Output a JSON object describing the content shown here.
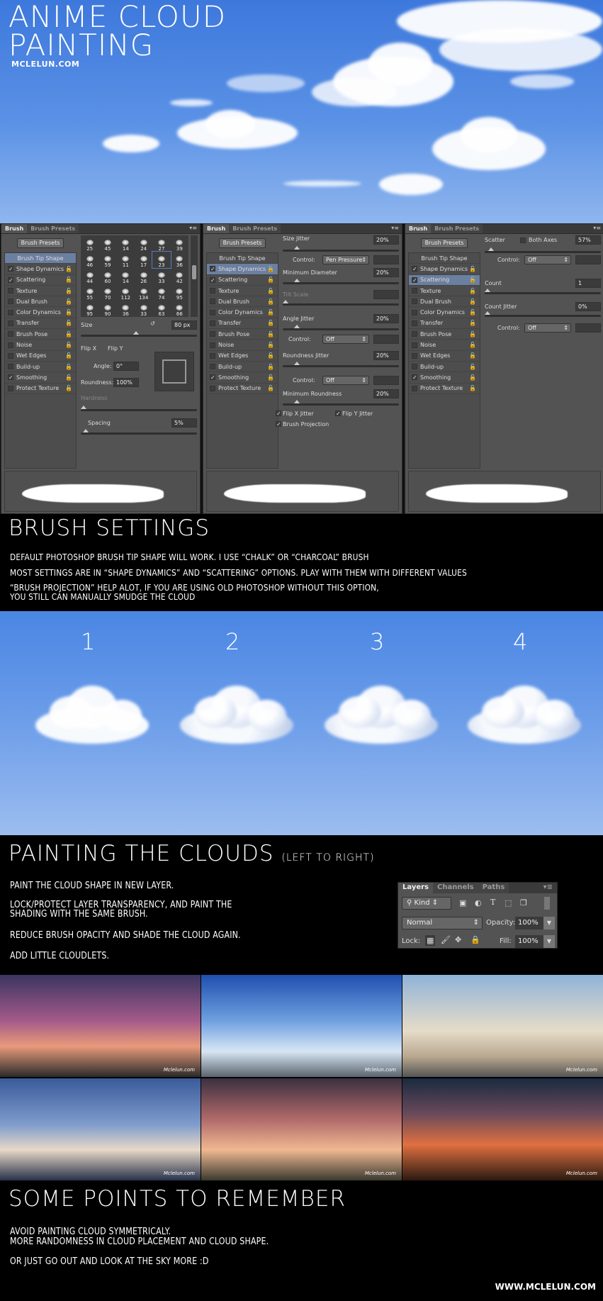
{
  "hero": {
    "title_line1": "ANIME CLOUD",
    "title_line2": "PAINTING",
    "site": "MCLELUN.COM"
  },
  "panels": [
    {
      "tabs": [
        "Brush",
        "Brush Presets"
      ],
      "presets_button": "Brush Presets",
      "selected": "Brush Tip Shape",
      "options": {
        "grid": [
          "25",
          "45",
          "14",
          "24",
          "27",
          "39",
          "46",
          "59",
          "11",
          "17",
          "23",
          "36",
          "44",
          "60",
          "14",
          "26",
          "33",
          "42",
          "55",
          "70",
          "112",
          "134",
          "74",
          "95",
          "95",
          "90",
          "36",
          "33",
          "63",
          "66"
        ],
        "selected_cell": "23",
        "size_label": "Size",
        "size_value": "80 px",
        "flip_x": "Flip X",
        "flip_y": "Flip Y",
        "angle_label": "Angle:",
        "angle_value": "0°",
        "roundness_label": "Roundness:",
        "roundness_value": "100%",
        "hardness_label": "Hardness",
        "spacing_label": "Spacing",
        "spacing_value": "5%"
      }
    },
    {
      "tabs": [
        "Brush",
        "Brush Presets"
      ],
      "presets_button": "Brush Presets",
      "selected": "Shape Dynamics",
      "options": {
        "size_jitter": "Size Jitter",
        "size_jitter_value": "20%",
        "control_label": "Control:",
        "control1": "Pen Pressure",
        "min_diameter": "Minimum Diameter",
        "min_diameter_value": "20%",
        "tilt_scale": "Tilt Scale",
        "angle_jitter": "Angle Jitter",
        "angle_jitter_value": "20%",
        "control2": "Off",
        "roundness_jitter": "Roundness Jitter",
        "roundness_jitter_value": "20%",
        "control3": "Off",
        "min_roundness": "Minimum Roundness",
        "min_roundness_value": "20%",
        "flip_x_jitter": "Flip X Jitter",
        "flip_y_jitter": "Flip Y Jitter",
        "brush_projection": "Brush Projection"
      }
    },
    {
      "tabs": [
        "Brush",
        "Brush Presets"
      ],
      "presets_button": "Brush Presets",
      "selected": "Scattering",
      "options": {
        "scatter": "Scatter",
        "both_axes": "Both Axes",
        "scatter_value": "57%",
        "control_label": "Control:",
        "control1": "Off",
        "count": "Count",
        "count_value": "1",
        "count_jitter": "Count Jitter",
        "count_jitter_value": "0%",
        "control2": "Off"
      }
    }
  ],
  "brush_list": [
    {
      "label": "Brush Tip Shape",
      "head": true
    },
    {
      "label": "Shape Dynamics",
      "checked": true
    },
    {
      "label": "Scattering",
      "checked": true
    },
    {
      "label": "Texture",
      "checked": false
    },
    {
      "label": "Dual Brush",
      "checked": false
    },
    {
      "label": "Color Dynamics",
      "checked": false
    },
    {
      "label": "Transfer",
      "checked": false
    },
    {
      "label": "Brush Pose",
      "checked": false
    },
    {
      "label": "Noise",
      "checked": false
    },
    {
      "label": "Wet Edges",
      "checked": false
    },
    {
      "label": "Build-up",
      "checked": false
    },
    {
      "label": "Smoothing",
      "checked": true
    },
    {
      "label": "Protect Texture",
      "checked": false
    }
  ],
  "brush_settings": {
    "title": "BRUSH SETTINGS",
    "lines": [
      "DEFAULT PHOTOSHOP BRUSH TIP SHAPE WILL WORK. I USE “CHALK” OR “CHARCOAL” BRUSH",
      "MOST SETTINGS ARE IN “SHAPE DYNAMICS” AND “SCATTERING” OPTIONS. PLAY WITH THEM WITH DIFFERENT VALUES",
      "“BRUSH PROJECTION” HELP ALOT, IF YOU ARE USING OLD PHOTOSHOP WITHOUT THIS OPTION,",
      "YOU STILL CAN MANUALLY SMUDGE THE CLOUD"
    ]
  },
  "steps": [
    "1",
    "2",
    "3",
    "4"
  ],
  "painting": {
    "title": "PAINTING THE CLOUDS",
    "subtitle": "(LEFT TO RIGHT)",
    "lines": [
      "PAINT THE CLOUD SHAPE IN NEW LAYER.",
      "LOCK/PROTECT LAYER TRANSPARENCY, AND PAINT THE",
      "SHADING WITH THE SAME BRUSH.",
      "REDUCE BRUSH OPACITY AND SHADE THE CLOUD AGAIN.",
      "ADD LITTLE CLOUDLETS."
    ]
  },
  "layers_panel": {
    "tabs": [
      "Layers",
      "Channels",
      "Paths"
    ],
    "kind": "Kind",
    "blend": "Normal",
    "opacity_label": "Opacity:",
    "opacity": "100%",
    "lock_label": "Lock:",
    "fill_label": "Fill:",
    "fill": "100%"
  },
  "photos": {
    "signature": "Mclelun.com"
  },
  "points": {
    "title": "SOME POINTS TO REMEMBER",
    "lines": [
      "AVOID PAINTING CLOUD SYMMETRICALY.",
      "MORE RANDOMNESS IN CLOUD PLACEMENT AND CLOUD SHAPE.",
      "OR JUST GO OUT AND LOOK AT THE SKY MORE :D"
    ],
    "url": "WWW.MCLELUN.COM"
  },
  "colors": {
    "sky": "#4a86e4",
    "panel": "#535353",
    "selected_item": "#6b7fa0",
    "background": "#000000"
  }
}
